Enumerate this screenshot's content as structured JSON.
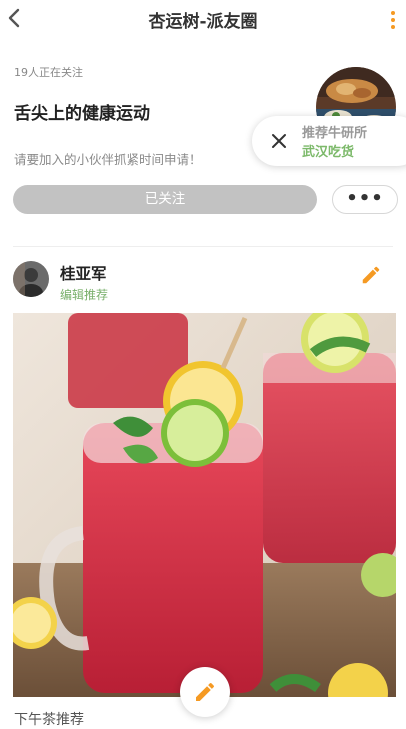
{
  "header": {
    "title": "杏运树-派友圈",
    "back_icon": "chevron-left-icon",
    "menu_icon": "more-vertical-icon",
    "accent_color": "#f59a23"
  },
  "group": {
    "followers_text": "19人正在关注",
    "name": "舌尖上的健康运动",
    "invite_text": "请要加入的小伙伴抓紧时间申请！",
    "follow_button_label": "已关注",
    "more_button_label": "•••"
  },
  "popup": {
    "line1": "推荐牛研所",
    "line2": "武汉吃货",
    "close_icon": "close-icon"
  },
  "post": {
    "author_name": "桂亚军",
    "author_tag": "编辑推荐",
    "edit_icon": "pencil-icon",
    "caption": "下午茶推荐"
  },
  "fab": {
    "icon": "pencil-icon"
  }
}
